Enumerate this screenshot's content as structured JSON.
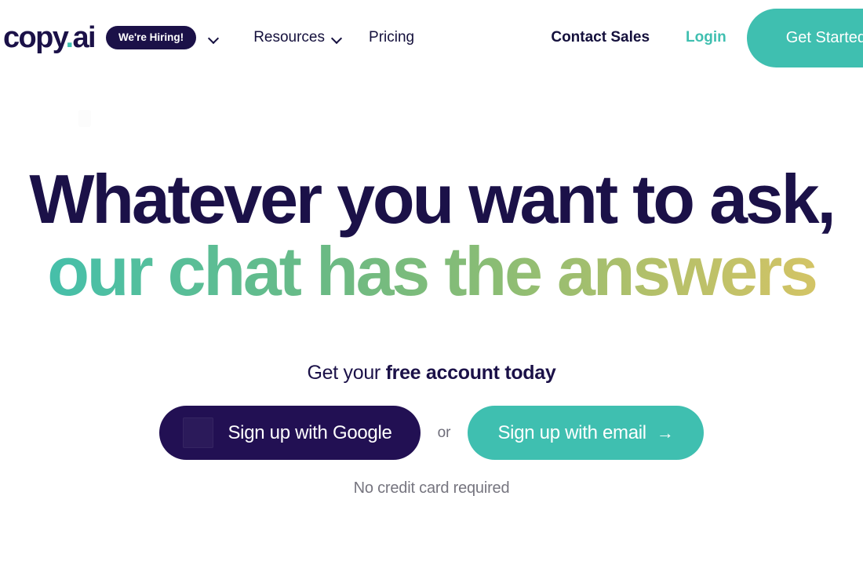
{
  "navbar": {
    "logo": {
      "name": "copy",
      "dot": ".",
      "suffix": "ai"
    },
    "hiring_badge": "We're Hiring!",
    "hiring_chevron_icon": "chevron-down-icon",
    "links": [
      {
        "label": "Resources",
        "has_chevron": true,
        "chevron_icon": "chevron-down-icon"
      },
      {
        "label": "Pricing",
        "has_chevron": false
      }
    ],
    "contact_sales": "Contact Sales",
    "login": "Login",
    "get_started": "Get Started"
  },
  "hero": {
    "headline_line1": "Whatever you want to ask,",
    "headline_line2": "our chat has the answers",
    "subhead_prefix": "Get your ",
    "subhead_bold": "free account today",
    "cta": {
      "google_label": "Sign up with Google",
      "google_icon": "google-logo-icon",
      "or": "or",
      "email_label": "Sign up with email",
      "email_arrow_icon": "→"
    },
    "disclaimer": "No credit card required"
  },
  "colors": {
    "brand_navy": "#1b1148",
    "brand_teal": "#3fbfb0",
    "button_dark": "#221053",
    "gradient_start": "#3fbfb0",
    "gradient_mid": "#6fb880",
    "gradient_end": "#dcc564",
    "muted_text": "#76757f",
    "background": "#ffffff"
  }
}
